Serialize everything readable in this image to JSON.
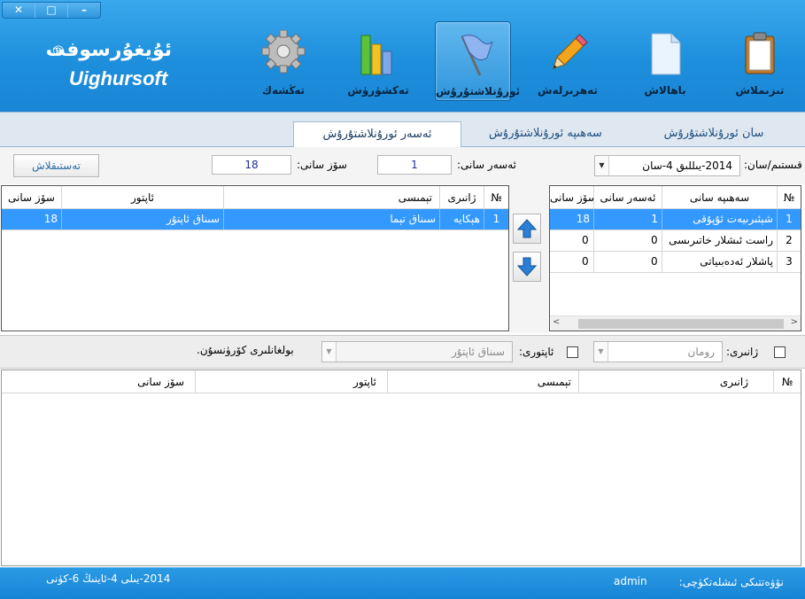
{
  "window": {
    "close": "✕",
    "maximize": "□",
    "minimize": "–"
  },
  "logo": {
    "name_ug": "ئۇيغۇرسوفت",
    "reg_mark": "®",
    "name_en": "Uighursoft"
  },
  "toolbar_items": [
    {
      "label": "تىزىملاش",
      "icon": "clipboard-icon"
    },
    {
      "label": "باھالاش",
      "icon": "document-icon"
    },
    {
      "label": "تەھرىرلەش",
      "icon": "pencil-icon"
    },
    {
      "label": "ئورۇنلاشتۇرۇش",
      "icon": "flag-icon",
      "active": true
    },
    {
      "label": "تەكشۈرۈش",
      "icon": "bar-chart-icon"
    },
    {
      "label": "تەڭشەك",
      "icon": "gear-icon"
    }
  ],
  "tabs": [
    {
      "label": "سان ئورۇنلاشتۇرۇش"
    },
    {
      "label": "سەھىپە ئورۇنلاشتۇرۇش"
    },
    {
      "label": "ئەسەر ئورۇنلاشتۇرۇش",
      "active": true
    }
  ],
  "controls": {
    "issue_label": "قىستىم/سان:",
    "issue_value": "2014-يىللىق 4-سان",
    "works_count_label": "ئەسەر سانى:",
    "works_count_value": "1",
    "word_count_label": "سۆز سانى:",
    "word_count_value": "18",
    "confirm_button": "تەستىقلاش"
  },
  "right_grid": {
    "headers": [
      "№",
      "سەھىپە سانى",
      "ئەسەر سانى",
      "سۆز سانى"
    ],
    "rows": [
      {
        "num": "1",
        "section": "شېئىرىيەت ئۇپۇقى",
        "works": "1",
        "words": "18",
        "selected": true
      },
      {
        "num": "2",
        "section": "راست ئىشلار خاتىرىسى",
        "works": "0",
        "words": "0"
      },
      {
        "num": "3",
        "section": "پاشلار ئەدەبىياتى",
        "works": "0",
        "words": "0"
      }
    ]
  },
  "left_grid": {
    "headers": [
      "№",
      "ژانىرى",
      "تېمىسى",
      "ئاپتور",
      "سۆز سانى"
    ],
    "rows": [
      {
        "num": "1",
        "genre": "ھېكايە",
        "topic": "سىناق تېما",
        "author": "سىناق ئاپتۇر",
        "words": "18",
        "selected": true
      }
    ]
  },
  "filter": {
    "genre_label": "ژانىرى:",
    "genre_value": "رومان",
    "author_label": "ئاپتورى:",
    "author_value": "سىناق ئاپتۇر",
    "found_text": "بولغانلىرى كۆرۈنسۇن."
  },
  "bottom_grid": {
    "headers": [
      "№",
      "ژانىرى",
      "تېمىسى",
      "ئاپتور",
      "سۆز سانى"
    ]
  },
  "status": {
    "user_label": "نۆۋەتتىكى ئىشلەتكۈچى:",
    "user_value": "admin",
    "date": "2014-يىلى 4-ئاينىڭ 6-كۈنى"
  },
  "colors": {
    "header_blue": "#1d8fdc",
    "selection_blue": "#3399ff"
  }
}
